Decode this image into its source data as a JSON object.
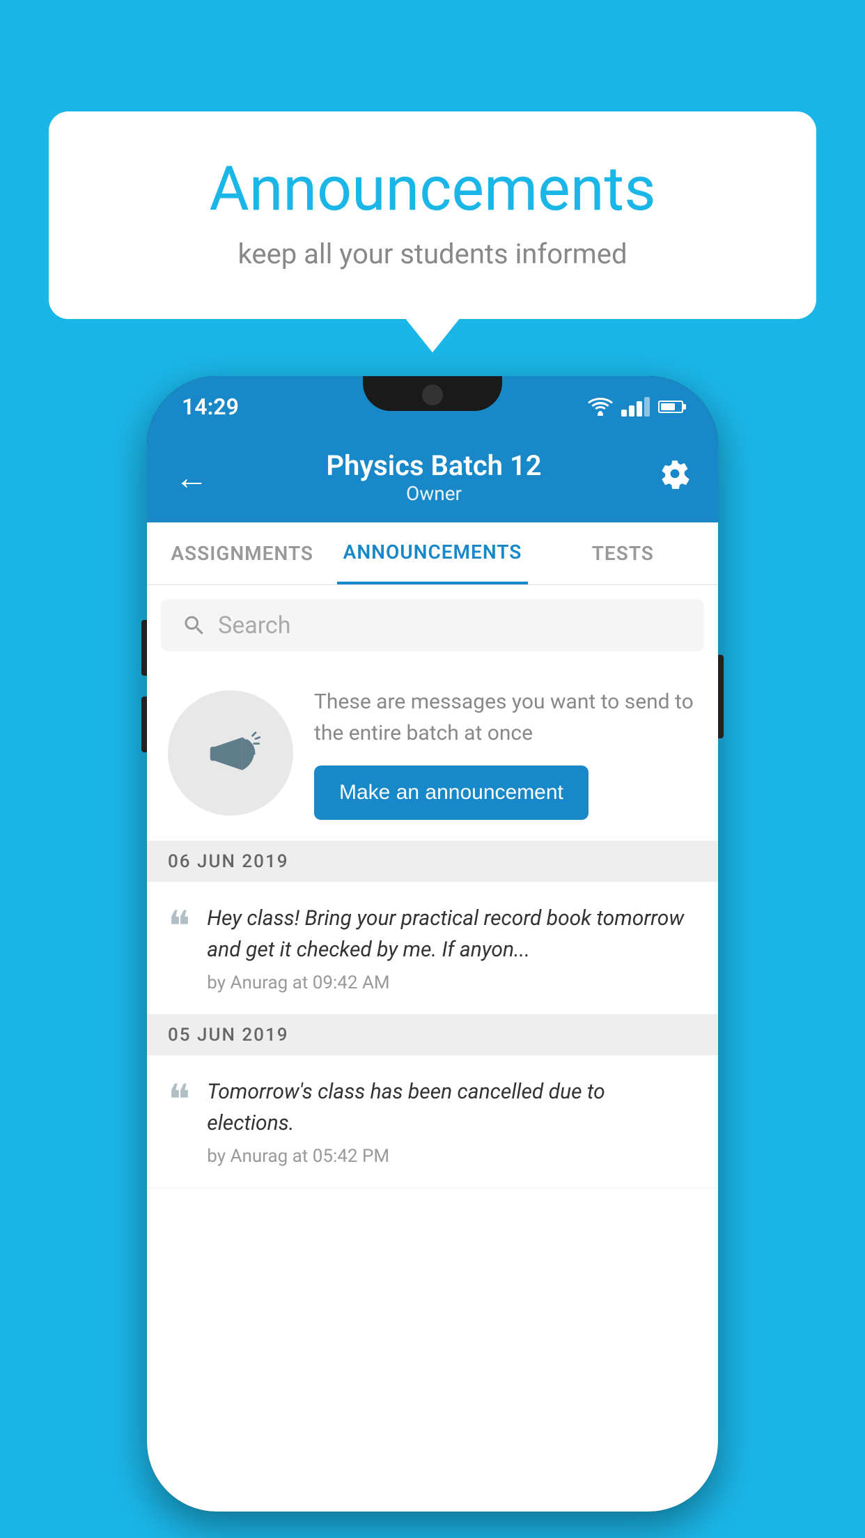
{
  "background_color": "#1bb6e8",
  "speech_bubble": {
    "title": "Announcements",
    "subtitle": "keep all your students informed"
  },
  "phone": {
    "status_bar": {
      "time": "14:29"
    },
    "app_bar": {
      "back_label": "←",
      "title": "Physics Batch 12",
      "subtitle": "Owner",
      "settings_label": "⚙"
    },
    "tabs": [
      {
        "label": "ASSIGNMENTS",
        "active": false
      },
      {
        "label": "ANNOUNCEMENTS",
        "active": true
      },
      {
        "label": "TESTS",
        "active": false
      }
    ],
    "search": {
      "placeholder": "Search"
    },
    "promo": {
      "text": "These are messages you want to send to the entire batch at once",
      "button_label": "Make an announcement"
    },
    "announcements": [
      {
        "date": "06  JUN  2019",
        "items": [
          {
            "text": "Hey class! Bring your practical record book tomorrow and get it checked by me. If anyon...",
            "meta": "by Anurag at 09:42 AM"
          }
        ]
      },
      {
        "date": "05  JUN  2019",
        "items": [
          {
            "text": "Tomorrow's class has been cancelled due to elections.",
            "meta": "by Anurag at 05:42 PM"
          }
        ]
      }
    ]
  }
}
